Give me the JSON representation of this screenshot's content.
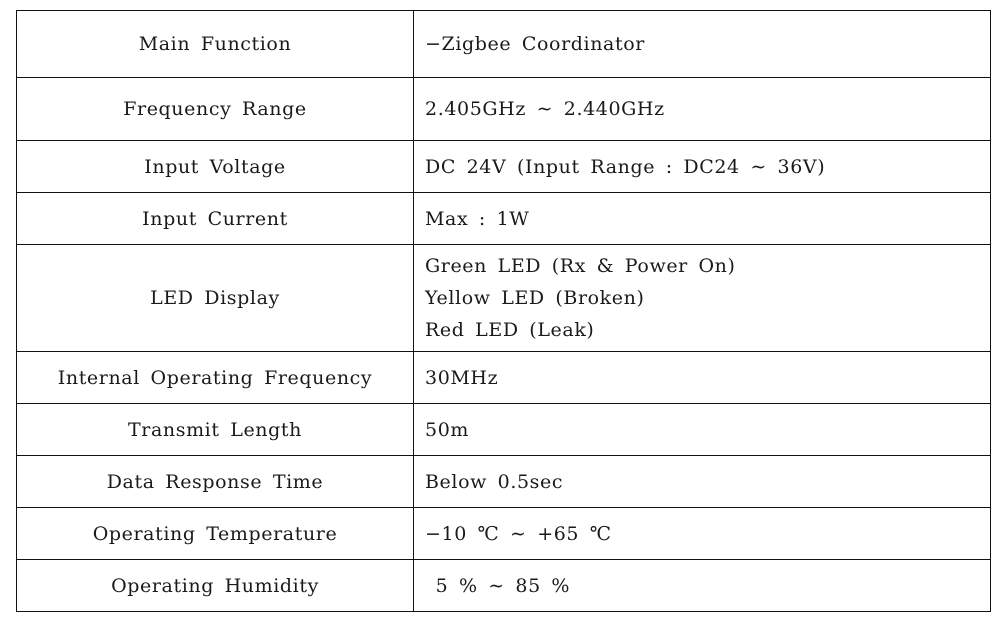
{
  "spec_table": {
    "rows": [
      {
        "label": "Main Function",
        "values": [
          "−Zigbee Coordinator"
        ]
      },
      {
        "label": "Frequency Range",
        "values": [
          "2.405GHz ∼ 2.440GHz"
        ]
      },
      {
        "label": "Input Voltage",
        "values": [
          "DC 24V (Input Range : DC24 ∼ 36V)"
        ]
      },
      {
        "label": "Input Current",
        "values": [
          "Max : 1W"
        ]
      },
      {
        "label": "LED Display",
        "values": [
          "Green LED (Rx & Power On)",
          "Yellow LED (Broken)",
          "Red LED (Leak)"
        ]
      },
      {
        "label": "Internal Operating Frequency",
        "values": [
          "30MHz"
        ]
      },
      {
        "label": "Transmit Length",
        "values": [
          "50m"
        ]
      },
      {
        "label": "Data Response Time",
        "values": [
          "Below 0.5sec"
        ]
      },
      {
        "label": "Operating Temperature",
        "values": [
          "−10 ℃ ∼ +65 ℃"
        ]
      },
      {
        "label": "Operating Humidity",
        "values": [
          " 5 % ∼ 85 %"
        ]
      }
    ]
  }
}
